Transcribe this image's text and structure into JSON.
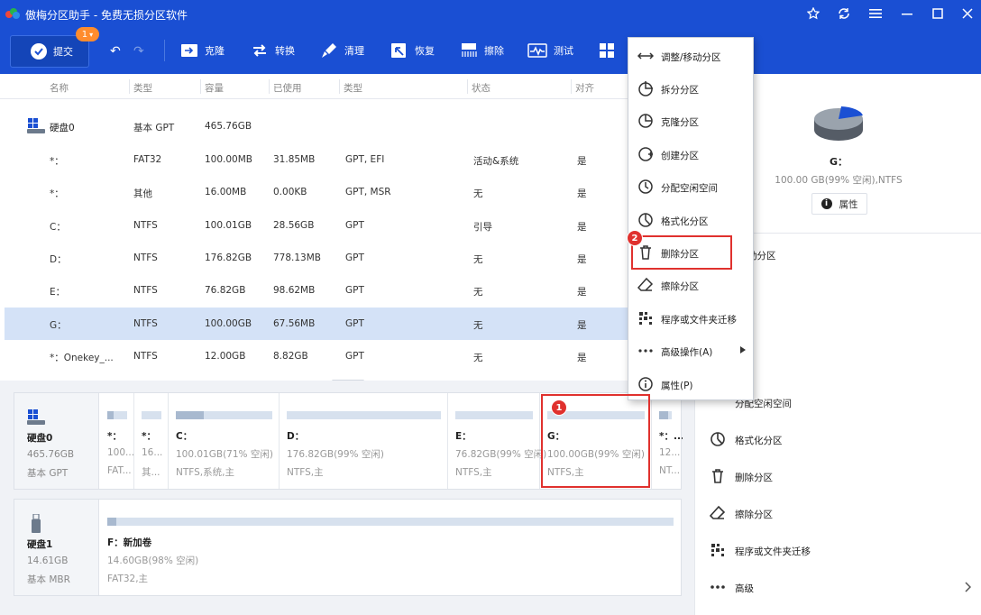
{
  "titlebar": {
    "title": "傲梅分区助手 - 免费无损分区软件"
  },
  "toolbar": {
    "submit_label": "提交",
    "badge": "1",
    "buttons": [
      "克隆",
      "转换",
      "清理",
      "恢复",
      "擦除",
      "测试"
    ]
  },
  "table": {
    "headers": [
      "名称",
      "类型",
      "容量",
      "已使用",
      "类型",
      "状态",
      "对齐"
    ],
    "disk_row": {
      "name": "硬盘0",
      "type": "基本 GPT",
      "capacity": "465.76GB"
    },
    "rows": [
      {
        "name": "*：",
        "fs": "FAT32",
        "cap": "100.00MB",
        "used": "31.85MB",
        "type": "GPT, EFI",
        "status": "活动&系统",
        "align": "是"
      },
      {
        "name": "*：",
        "fs": "其他",
        "cap": "16.00MB",
        "used": "0.00KB",
        "type": "GPT, MSR",
        "status": "无",
        "align": "是"
      },
      {
        "name": "C：",
        "fs": "NTFS",
        "cap": "100.01GB",
        "used": "28.56GB",
        "type": "GPT",
        "status": "引导",
        "align": "是"
      },
      {
        "name": "D：",
        "fs": "NTFS",
        "cap": "176.82GB",
        "used": "778.13MB",
        "type": "GPT",
        "status": "无",
        "align": "是"
      },
      {
        "name": "E：",
        "fs": "NTFS",
        "cap": "76.82GB",
        "used": "98.62MB",
        "type": "GPT",
        "status": "无",
        "align": "是"
      },
      {
        "name": "G：",
        "fs": "NTFS",
        "cap": "100.00GB",
        "used": "67.56MB",
        "type": "GPT",
        "status": "无",
        "align": "是"
      },
      {
        "name": "*：Onekey_...",
        "fs": "NTFS",
        "cap": "12.00GB",
        "used": "8.82GB",
        "type": "GPT",
        "status": "无",
        "align": "是"
      }
    ]
  },
  "disk0": {
    "name": "硬盘0",
    "size": "465.76GB",
    "type": "基本 GPT",
    "parts": [
      {
        "label": "*：",
        "l1": "100...",
        "l2": "FAT..."
      },
      {
        "label": "*：",
        "l1": "16...",
        "l2": "其..."
      },
      {
        "label": "C：",
        "l1": "100.01GB(71% 空闲)",
        "l2": "NTFS,系统,主"
      },
      {
        "label": "D：",
        "l1": "176.82GB(99% 空闲)",
        "l2": "NTFS,主"
      },
      {
        "label": "E：",
        "l1": "76.82GB(99% 空闲)",
        "l2": "NTFS,主"
      },
      {
        "label": "G：",
        "l1": "100.00GB(99% 空闲)",
        "l2": "NTFS,主"
      },
      {
        "label": "*：...",
        "l1": "12...",
        "l2": "NT..."
      }
    ]
  },
  "disk1": {
    "name": "硬盘1",
    "size": "14.61GB",
    "type": "基本 MBR",
    "part": {
      "label": "F：新加卷",
      "l1": "14.60GB(98% 空闲)",
      "l2": "FAT32,主"
    }
  },
  "rightpanel": {
    "title": "G：",
    "info": "100.00 GB(99% 空闲),NTFS",
    "prop_label": "属性",
    "items": [
      "/移动分区",
      "分区",
      "分区",
      "分区",
      "分配空闲空间",
      "格式化分区",
      "删除分区",
      "擦除分区",
      "程序或文件夹迁移",
      "高级"
    ]
  },
  "menu": {
    "items": [
      "调整/移动分区",
      "拆分分区",
      "克隆分区",
      "创建分区",
      "分配空闲空间",
      "格式化分区",
      "删除分区",
      "擦除分区",
      "程序或文件夹迁移",
      "高级操作(A)",
      "属性(P)"
    ]
  },
  "annotations": {
    "one": "1",
    "two": "2",
    "color": "#e0312e"
  },
  "colors": {
    "accent": "#1a4fd3",
    "selected_row": "#d4e2f7"
  }
}
